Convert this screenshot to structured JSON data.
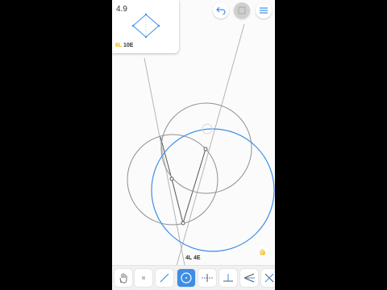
{
  "level": {
    "number": "4.9",
    "score_l": "6L",
    "score_e": "10E"
  },
  "status": {
    "move_count": "4L 4E"
  },
  "colors": {
    "accent": "#3d8de6",
    "construction": "#8a8a8a",
    "gold": "#f0b400"
  },
  "toolbar": {
    "tools": [
      {
        "icon": "hand-icon"
      },
      {
        "icon": "point-icon"
      },
      {
        "icon": "line-icon"
      },
      {
        "icon": "circle-icon",
        "active": true
      },
      {
        "icon": "perpendicular-bisector-icon"
      },
      {
        "icon": "perpendicular-icon"
      },
      {
        "icon": "angle-bisector-icon"
      },
      {
        "icon": "parallel-icon"
      }
    ]
  }
}
